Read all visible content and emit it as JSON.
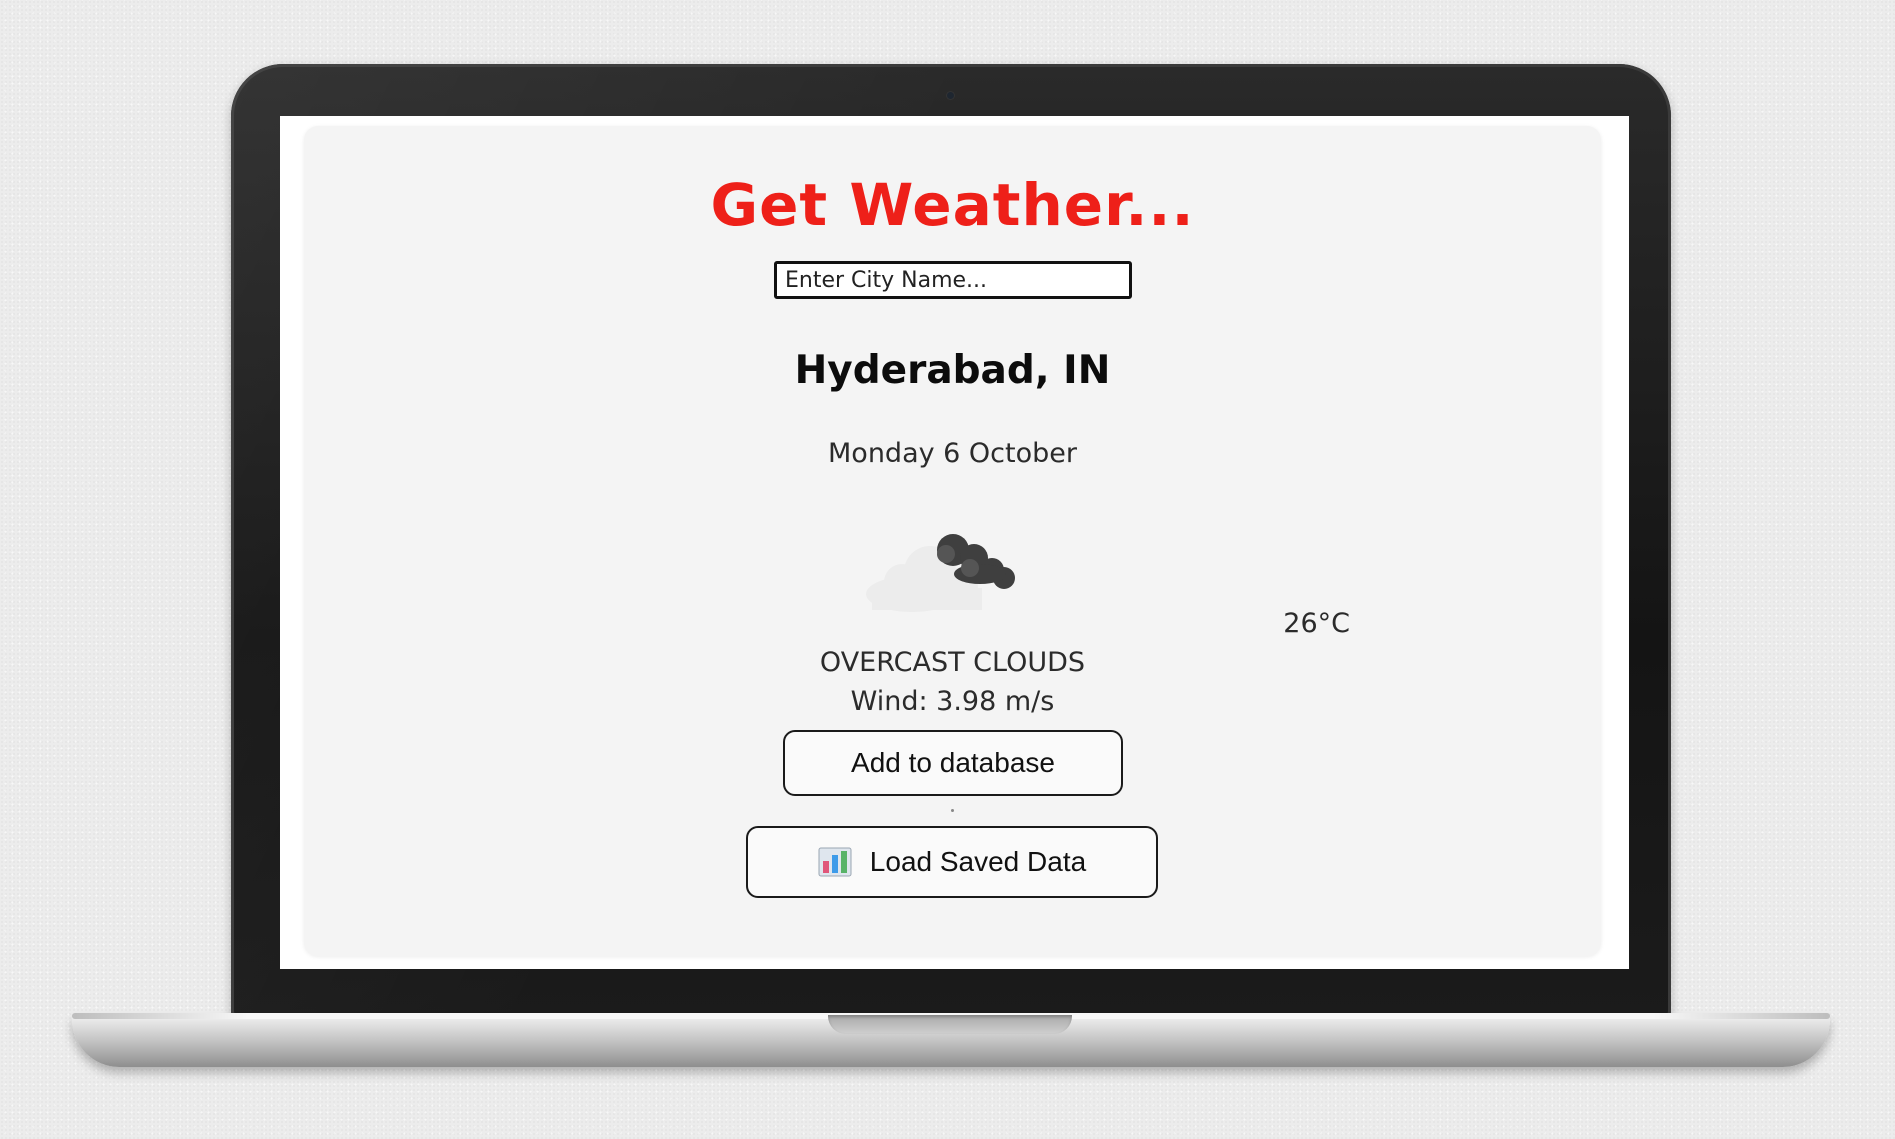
{
  "app": {
    "title": "Get Weather...",
    "title_color": "#ee2019"
  },
  "search": {
    "placeholder": "Enter City Name...",
    "value": ""
  },
  "weather": {
    "location": "Hyderabad, IN",
    "date": "Monday 6 October",
    "icon": "overcast-clouds-icon",
    "temperature": "26°C",
    "description": "OVERCAST CLOUDS",
    "wind": "Wind: 3.98 m/s"
  },
  "actions": {
    "add_label": "Add to database",
    "load_label": "Load Saved Data",
    "load_icon": "bar-chart-icon"
  }
}
